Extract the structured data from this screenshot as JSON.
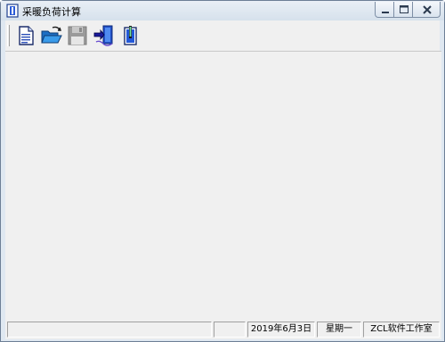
{
  "window": {
    "title": "采暖负荷计算",
    "app_icon": "app-icon"
  },
  "caption_buttons": [
    {
      "name": "minimize",
      "icon": "minimize-icon"
    },
    {
      "name": "maximize",
      "icon": "maximize-icon"
    },
    {
      "name": "close",
      "icon": "close-icon"
    }
  ],
  "toolbar": {
    "buttons": [
      {
        "icon": "new-document-icon",
        "enabled": true
      },
      {
        "icon": "open-folder-icon",
        "enabled": true
      },
      {
        "icon": "save-disk-icon",
        "enabled": false
      },
      {
        "icon": "exit-door-icon",
        "enabled": true
      },
      {
        "icon": "about-book-icon",
        "enabled": true
      }
    ]
  },
  "statusbar": {
    "main": "",
    "blank": "",
    "date": "2019年6月3日",
    "weekday": "星期一",
    "company": "ZCL软件工作室"
  },
  "colors": {
    "titlebar": "#dfe8f1",
    "client": "#f0f0f0",
    "close_red": "#c75050"
  }
}
